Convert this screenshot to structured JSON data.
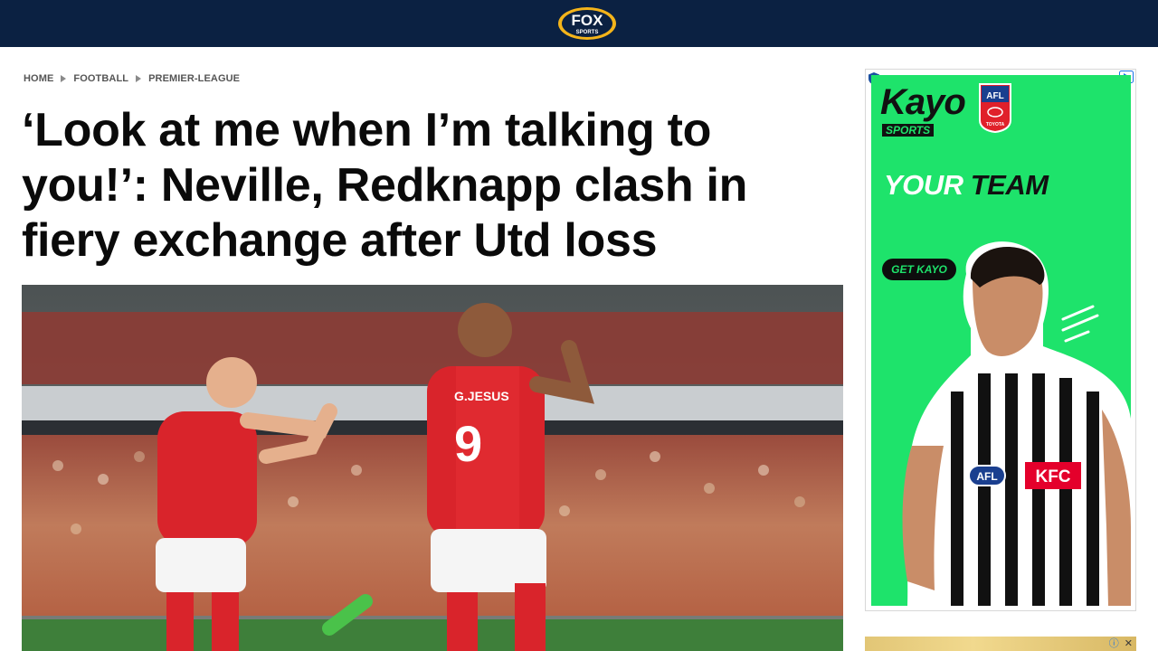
{
  "header": {
    "logo": {
      "line1": "FOX",
      "line2": "SPORTS"
    }
  },
  "breadcrumb": {
    "items": [
      "HOME",
      "FOOTBALL",
      "PREMIER-LEAGUE"
    ]
  },
  "article": {
    "headline": "‘Look at me when I’m talking to you!’: Neville, Redknapp clash in fiery exchange after Utd loss",
    "hero_image": {
      "shirt_name": "G.JESUS",
      "shirt_number": "9"
    }
  },
  "ad_sidebar": {
    "brand": "Kayo",
    "brand_sub": "SPORTS",
    "afl_badge_top": "AFL",
    "afl_badge_bottom": "TOYOTA",
    "headline_white": "YOUR",
    "headline_black": "TEAM",
    "cta": "GET KAYO",
    "jersey_afl": "AFL",
    "jersey_sponsor": "KFC",
    "colors": {
      "background": "#1ee36b",
      "cta_bg": "#0d0d0d"
    }
  },
  "ad_bottom": {
    "info_icon": "info-icon",
    "close_icon": "close-icon"
  },
  "colors": {
    "topbar": "#0b2142",
    "headline": "#0a0a0a",
    "breadcrumb": "#555555"
  }
}
